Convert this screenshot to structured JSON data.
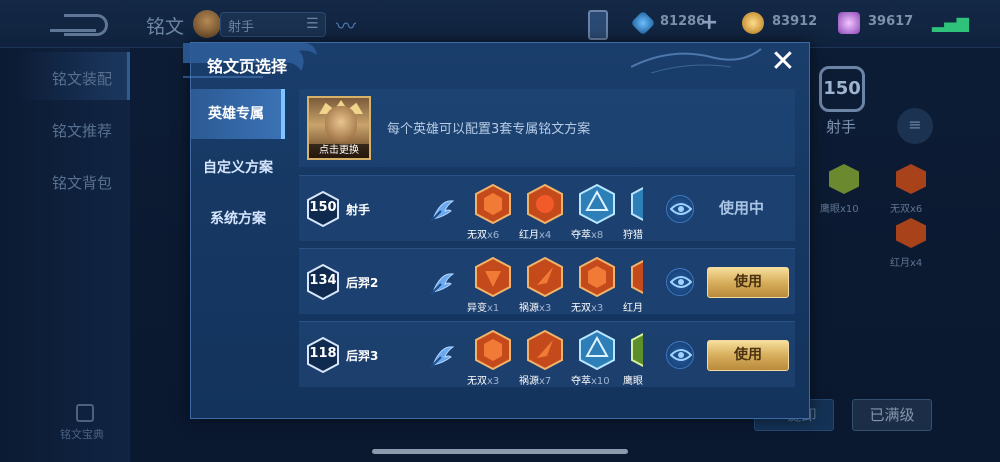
{
  "background": {
    "title": "铭文",
    "hero_tag": "射手",
    "currencies": [
      {
        "icon": "diamond-gem-icon",
        "value": "81286"
      },
      {
        "icon": "gold-coin-icon",
        "value": "83912"
      },
      {
        "icon": "purple-crystal-icon",
        "value": "39617"
      }
    ],
    "sidebar": [
      {
        "label": "铭文装配"
      },
      {
        "label": "铭文推荐"
      },
      {
        "label": "铭文背包"
      }
    ],
    "sidebar_bottom": "铭文宝典",
    "level": "150",
    "role": "射手",
    "side_runes": [
      {
        "name": "鹰眼",
        "count": "x10"
      },
      {
        "name": "无双",
        "count": "x6"
      },
      {
        "name": "红月",
        "count": "x4"
      }
    ],
    "buttons": {
      "unload": "一键卸",
      "maxed": "已满级"
    }
  },
  "modal": {
    "title": "铭文页选择",
    "close_icon": "close-icon",
    "tabs": [
      {
        "label": "英雄专属",
        "active": true
      },
      {
        "label": "自定义方案",
        "active": false
      },
      {
        "label": "系统方案",
        "active": false
      }
    ],
    "hero_info": {
      "portrait_label": "点击更换",
      "description": "每个英雄可以配置3套专属铭文方案"
    },
    "sets": [
      {
        "level": "150",
        "name": "射手",
        "runes": [
          {
            "name": "无双",
            "count": "x6",
            "color": "#d8561f"
          },
          {
            "name": "红月",
            "count": "x4",
            "color": "#d8561f"
          },
          {
            "name": "夺萃",
            "count": "x8",
            "color": "#4aa9d6"
          },
          {
            "name": "狩猎",
            "count": "",
            "color": "#4aa9d6"
          }
        ],
        "status": "使用中",
        "action": ""
      },
      {
        "level": "134",
        "name": "后羿2",
        "runes": [
          {
            "name": "异变",
            "count": "x1",
            "color": "#d8561f"
          },
          {
            "name": "祸源",
            "count": "x3",
            "color": "#d8561f"
          },
          {
            "name": "无双",
            "count": "x3",
            "color": "#d8561f"
          },
          {
            "name": "红月",
            "count": "",
            "color": "#d8561f"
          }
        ],
        "status": "",
        "action": "使用"
      },
      {
        "level": "118",
        "name": "后羿3",
        "runes": [
          {
            "name": "无双",
            "count": "x3",
            "color": "#d8561f"
          },
          {
            "name": "祸源",
            "count": "x7",
            "color": "#d8561f"
          },
          {
            "name": "夺萃",
            "count": "x10",
            "color": "#4aa9d6"
          },
          {
            "name": "鹰眼",
            "count": "",
            "color": "#7cb342"
          }
        ],
        "status": "",
        "action": "使用"
      }
    ]
  },
  "colors": {
    "accent_gold": "#d7ae5c",
    "modal_bg": "#163863",
    "active_tab": "#3a72b5"
  }
}
